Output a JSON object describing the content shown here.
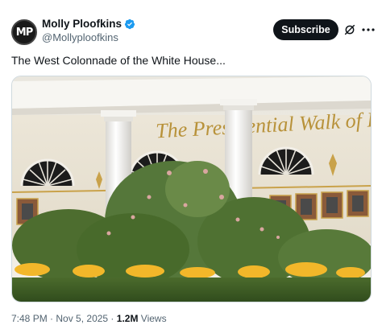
{
  "author": {
    "avatar_initials": "MP",
    "display_name": "Molly Ploofkins",
    "handle": "@Mollyploofkins",
    "verified_color": "#1d9bf0"
  },
  "actions": {
    "subscribe_label": "Subscribe",
    "grok_icon": "grok-icon",
    "more_icon": "more-icon"
  },
  "tweet": {
    "text": "The West Colonnade of the White House..."
  },
  "media": {
    "sign_text": "The Presidential Walk of Fame"
  },
  "meta": {
    "time": "7:48 PM",
    "sep1": " · ",
    "date": "Nov 5, 2025",
    "sep2": " · ",
    "views_count": "1.2M",
    "views_label": " Views"
  }
}
